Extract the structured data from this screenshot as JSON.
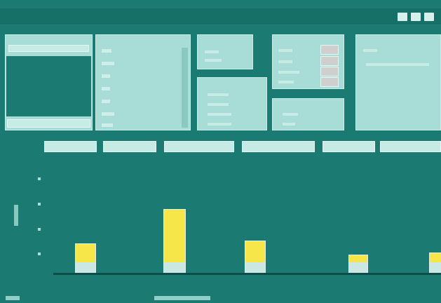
{
  "window": {
    "title": "",
    "controls": [
      "minimize",
      "maximize",
      "close"
    ]
  },
  "panel_left": {
    "header": "",
    "field_label": "",
    "field_value": "",
    "footer": ""
  },
  "panel_list": {
    "header": "",
    "items": [
      "",
      "",
      "",
      "",
      "",
      "",
      "",
      ""
    ]
  },
  "panel_options_a": {
    "header": "",
    "options": [
      "",
      ""
    ]
  },
  "panel_options_b": {
    "header": "",
    "options": [
      "",
      "",
      "",
      ""
    ]
  },
  "panel_fields": {
    "header": "",
    "rows": [
      "",
      "",
      "",
      ""
    ]
  },
  "panel_small": {
    "header": "",
    "options": [
      "",
      ""
    ]
  },
  "panel_right": {
    "header": "",
    "line1": "",
    "line2": ""
  },
  "toolbar": {
    "buttons": [
      "",
      "",
      "",
      "",
      "",
      ""
    ]
  },
  "chart_data": {
    "type": "bar",
    "categories": [
      "",
      "",
      "",
      "",
      ""
    ],
    "series": [
      {
        "values": [
          3.2,
          6.8,
          3.5,
          2.0,
          2.2
        ]
      }
    ],
    "xlabel": "",
    "ylabel": "",
    "grid": false,
    "legend": "none",
    "colors": {
      "bar": "#f7e64a",
      "base": "#cbe7e4",
      "background": "#1b7a72",
      "axis": "#0f4b47"
    }
  }
}
